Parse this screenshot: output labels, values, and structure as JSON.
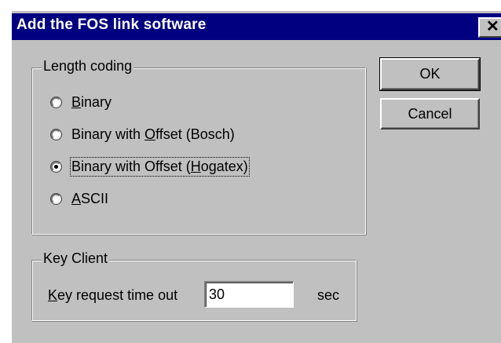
{
  "window": {
    "title": "Add the FOS link software",
    "close_glyph": "✕"
  },
  "length_coding": {
    "label": "Length coding",
    "options": [
      {
        "pre": "",
        "key": "B",
        "post": "inary",
        "checked": false
      },
      {
        "pre": "Binary with ",
        "key": "O",
        "post": "ffset (Bosch)",
        "checked": false
      },
      {
        "pre": "Binary with Offset (",
        "key": "H",
        "post": "ogatex)",
        "checked": true
      },
      {
        "pre": "",
        "key": "A",
        "post": "SCII",
        "checked": false
      }
    ]
  },
  "key_client": {
    "label": "Key Client",
    "timeout_label_key": "K",
    "timeout_label_rest": "ey request time out",
    "timeout_value": "30",
    "unit": "sec"
  },
  "buttons": {
    "ok": "OK",
    "cancel": "Cancel"
  }
}
